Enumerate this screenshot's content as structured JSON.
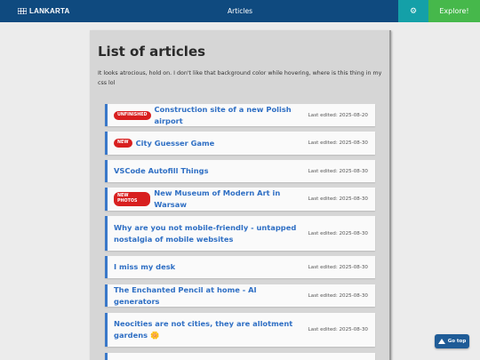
{
  "header": {
    "brand": "LANKARTA",
    "nav_articles": "Articles",
    "settings_icon": "gear-icon",
    "explore_label": "Explore!"
  },
  "main": {
    "title": "List of articles",
    "description": "It looks atrocious, hold on. I don't like that background color while hovering, where is this thing in my css lol",
    "articles": [
      {
        "badge": "UNFINISHED",
        "title": "Construction site of a new Polish airport",
        "edited": "Last edited: 2025-08-20"
      },
      {
        "badge": "NEW",
        "title": "City Guesser Game",
        "edited": "Last edited: 2025-08-30"
      },
      {
        "badge": "",
        "title": "VSCode Autofill Things",
        "edited": "Last edited: 2025-08-30"
      },
      {
        "badge": "NEW PHOTOS",
        "title": "New Museum of Modern Art in Warsaw",
        "edited": "Last edited: 2025-08-30"
      },
      {
        "badge": "",
        "title": "Why are you not mobile-friendly - untapped nostalgia of mobile websites",
        "edited": "Last edited: 2025-08-30"
      },
      {
        "badge": "",
        "title": "I miss my desk",
        "edited": "Last edited: 2025-08-30"
      },
      {
        "badge": "",
        "title": "The Enchanted Pencil at home - AI generators",
        "edited": "Last edited: 2025-08-30"
      },
      {
        "badge": "",
        "title": "Neocities are not cities, they are allotment gardens",
        "emoji": "🌼",
        "edited": "Last edited: 2025-08-30"
      }
    ]
  },
  "goto_top": {
    "label": "Go top",
    "icon": "triangle-up-icon"
  },
  "colors": {
    "topbar": "#0f4a7f",
    "settings": "#14a0a8",
    "explore": "#46b84b",
    "badge": "#d81f1f",
    "link": "#2f6fc4"
  }
}
